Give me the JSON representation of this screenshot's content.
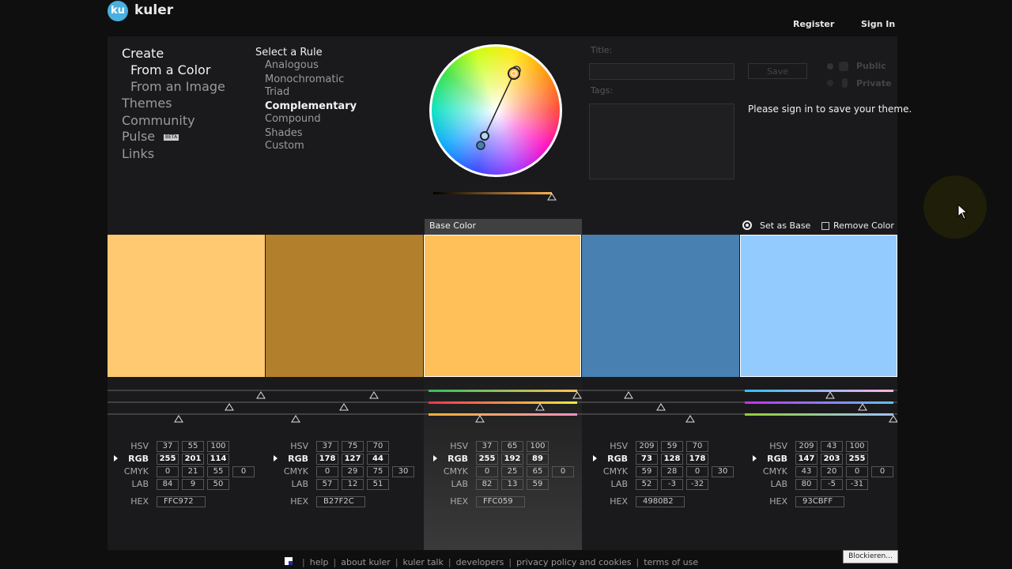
{
  "brand": {
    "badge": "ku",
    "name": "kuler"
  },
  "header": {
    "register": "Register",
    "sign_in": "Sign In"
  },
  "nav": {
    "create": "Create",
    "from_color": "From a Color",
    "from_image": "From an Image",
    "themes": "Themes",
    "community": "Community",
    "pulse": "Pulse",
    "pulse_badge": "BETA",
    "links": "Links"
  },
  "rules": {
    "heading": "Select a Rule",
    "items": [
      "Analogous",
      "Monochromatic",
      "Triad",
      "Complementary",
      "Compound",
      "Shades",
      "Custom"
    ],
    "selected": "Complementary"
  },
  "form": {
    "title_label": "Title:",
    "tags_label": "Tags:",
    "save": "Save",
    "public": "Public",
    "private": "Private",
    "signin_message": "Please sign in to save your theme."
  },
  "actions": {
    "base_color": "Base Color",
    "set_as_base": "Set as Base",
    "remove_color": "Remove Color"
  },
  "field_labels": {
    "hsv": "HSV",
    "rgb": "RGB",
    "cmyk": "CMYK",
    "lab": "LAB",
    "hex": "HEX"
  },
  "swatches": [
    {
      "color": "#FFC972",
      "hsv": [
        "37",
        "55",
        "100"
      ],
      "rgb": [
        "255",
        "201",
        "114"
      ],
      "cmyk": [
        "0",
        "21",
        "55",
        "0"
      ],
      "lab": [
        "84",
        "9",
        "50"
      ],
      "hex": "FFC972"
    },
    {
      "color": "#B27F2C",
      "hsv": [
        "37",
        "75",
        "70"
      ],
      "rgb": [
        "178",
        "127",
        "44"
      ],
      "cmyk": [
        "0",
        "29",
        "75",
        "30"
      ],
      "lab": [
        "57",
        "12",
        "51"
      ],
      "hex": "B27F2C"
    },
    {
      "color": "#FFC059",
      "hsv": [
        "37",
        "65",
        "100"
      ],
      "rgb": [
        "255",
        "192",
        "89"
      ],
      "cmyk": [
        "0",
        "25",
        "65",
        "0"
      ],
      "lab": [
        "82",
        "13",
        "59"
      ],
      "hex": "FFC059"
    },
    {
      "color": "#4980B2",
      "hsv": [
        "209",
        "59",
        "70"
      ],
      "rgb": [
        "73",
        "128",
        "178"
      ],
      "cmyk": [
        "59",
        "28",
        "0",
        "30"
      ],
      "lab": [
        "52",
        "-3",
        "-32"
      ],
      "hex": "4980B2"
    },
    {
      "color": "#93CBFF",
      "hsv": [
        "209",
        "43",
        "100"
      ],
      "rgb": [
        "147",
        "203",
        "255"
      ],
      "cmyk": [
        "43",
        "20",
        "0",
        "0"
      ],
      "lab": [
        "80",
        "-5",
        "-31"
      ],
      "hex": "93CBFF"
    }
  ],
  "base_index": 2,
  "footer": [
    "help",
    "about kuler",
    "kuler talk",
    "developers",
    "privacy policy and cookies",
    "terms of use"
  ],
  "blocker_button": "Blockieren..."
}
